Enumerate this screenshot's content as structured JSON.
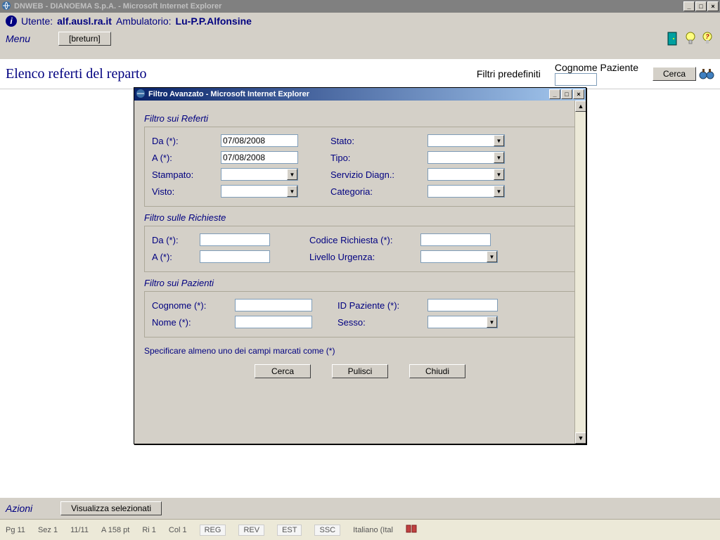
{
  "window": {
    "title": "DNWEB - DIANOEMA S.p.A. - Microsoft Internet Explorer"
  },
  "header": {
    "utente_label": "Utente:",
    "utente_value": "alf.ausl.ra.it",
    "ambulatorio_label": "Ambulatorio:",
    "ambulatorio_value": "Lu-P.P.Alfonsine",
    "menu": "Menu",
    "breturn": "[breturn]"
  },
  "page": {
    "title": "Elenco referti del reparto",
    "filtri_predefiniti": "Filtri predefiniti",
    "cognome_paziente": "Cognome Paziente",
    "cerca": "Cerca"
  },
  "modal": {
    "title": "Filtro Avanzato - Microsoft Internet Explorer",
    "sec1": "Filtro sui Referti",
    "sec2": "Filtro sulle Richieste",
    "sec3": "Filtro sui Pazienti",
    "da": "Da (*):",
    "a": "A (*):",
    "stampato": "Stampato:",
    "visto": "Visto:",
    "stato": "Stato:",
    "tipo": "Tipo:",
    "servizio": "Servizio Diagn.:",
    "categoria": "Categoria:",
    "codice_richiesta": "Codice Richiesta (*):",
    "livello_urgenza": "Livello Urgenza:",
    "cognome": "Cognome (*):",
    "nome": "Nome (*):",
    "id_paziente": "ID Paziente (*):",
    "sesso": "Sesso:",
    "da_val": "07/08/2008",
    "a_val": "07/08/2008",
    "footnote": "Specificare almeno uno dei campi marcati come (*)",
    "btn_cerca": "Cerca",
    "btn_pulisci": "Pulisci",
    "btn_chiudi": "Chiudi"
  },
  "actions": {
    "label": "Azioni",
    "visualizza": "Visualizza selezionati"
  },
  "status": {
    "pg": "Pg 11",
    "sez": "Sez 1",
    "pages": "11/11",
    "at": "A 158 pt",
    "ri": "Ri 1",
    "col": "Col 1",
    "reg": "REG",
    "rev": "REV",
    "est": "EST",
    "ssc": "SSC",
    "lang": "Italiano (Ital"
  }
}
